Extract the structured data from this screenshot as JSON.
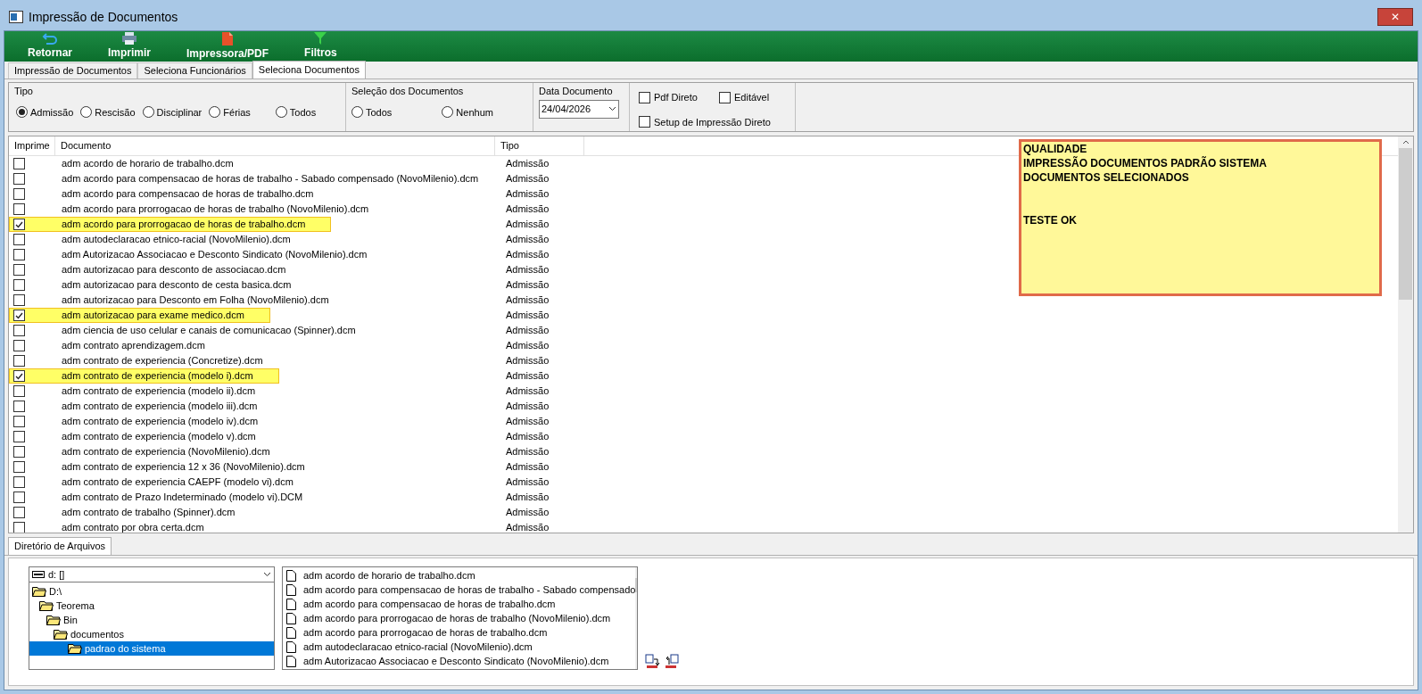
{
  "window": {
    "title": "Impressão de Documentos",
    "close": "✕"
  },
  "toolbar": [
    {
      "label": "Retornar",
      "kind": "return"
    },
    {
      "label": "Imprimir",
      "kind": "print"
    },
    {
      "label": "Impressora/PDF",
      "kind": "pdf"
    },
    {
      "label": "Filtros",
      "kind": "filter"
    }
  ],
  "tabs": [
    {
      "label": "Impressão de Documentos",
      "selected": false
    },
    {
      "label": "Seleciona Funcionários",
      "selected": false
    },
    {
      "label": "Seleciona Documentos",
      "selected": true
    }
  ],
  "tipo": {
    "title": "Tipo",
    "options": [
      {
        "label": "Admissão",
        "selected": true
      },
      {
        "label": "Rescisão",
        "selected": false
      },
      {
        "label": "Disciplinar",
        "selected": false
      },
      {
        "label": "Férias",
        "selected": false
      },
      {
        "label": "Todos",
        "selected": false
      }
    ]
  },
  "selecao": {
    "title": "Seleção dos Documentos",
    "options": [
      {
        "label": "Todos",
        "selected": false
      },
      {
        "label": "Nenhum",
        "selected": false
      }
    ]
  },
  "data_documento": {
    "title": "Data Documento",
    "value": "24/04/2026"
  },
  "options": [
    {
      "label": "Pdf Direto",
      "checked": false
    },
    {
      "label": "Editável",
      "checked": false
    },
    {
      "label": "Setup de Impressão Direto",
      "checked": false
    }
  ],
  "table": {
    "columns": [
      "Imprime",
      "Documento",
      "Tipo"
    ],
    "rows": [
      {
        "checked": false,
        "highlighted": false,
        "documento": "adm acordo de horario de trabalho.dcm",
        "tipo": "Admissão"
      },
      {
        "checked": false,
        "highlighted": false,
        "documento": "adm acordo para compensacao de horas de trabalho - Sabado compensado (NovoMilenio).dcm",
        "tipo": "Admissão"
      },
      {
        "checked": false,
        "highlighted": false,
        "documento": "adm acordo para compensacao de horas de trabalho.dcm",
        "tipo": "Admissão"
      },
      {
        "checked": false,
        "highlighted": false,
        "documento": "adm acordo para prorrogacao de horas de trabalho (NovoMilenio).dcm",
        "tipo": "Admissão"
      },
      {
        "checked": true,
        "highlighted": true,
        "documento": "adm acordo para prorrogacao de horas de trabalho.dcm",
        "tipo": "Admissão"
      },
      {
        "checked": false,
        "highlighted": false,
        "documento": "adm autodeclaracao etnico-racial (NovoMilenio).dcm",
        "tipo": "Admissão"
      },
      {
        "checked": false,
        "highlighted": false,
        "documento": "adm Autorizacao Associacao e Desconto Sindicato (NovoMilenio).dcm",
        "tipo": "Admissão"
      },
      {
        "checked": false,
        "highlighted": false,
        "documento": "adm autorizacao para desconto de associacao.dcm",
        "tipo": "Admissão"
      },
      {
        "checked": false,
        "highlighted": false,
        "documento": "adm autorizacao para desconto de cesta basica.dcm",
        "tipo": "Admissão"
      },
      {
        "checked": false,
        "highlighted": false,
        "documento": "adm autorizacao para Desconto em Folha (NovoMilenio).dcm",
        "tipo": "Admissão"
      },
      {
        "checked": true,
        "highlighted": true,
        "documento": "adm autorizacao para exame medico.dcm",
        "tipo": "Admissão"
      },
      {
        "checked": false,
        "highlighted": false,
        "documento": "adm ciencia de uso celular e canais de comunicacao (Spinner).dcm",
        "tipo": "Admissão"
      },
      {
        "checked": false,
        "highlighted": false,
        "documento": "adm contrato aprendizagem.dcm",
        "tipo": "Admissão"
      },
      {
        "checked": false,
        "highlighted": false,
        "documento": "adm contrato de experiencia (Concretize).dcm",
        "tipo": "Admissão"
      },
      {
        "checked": true,
        "highlighted": true,
        "documento": "adm contrato de experiencia (modelo i).dcm",
        "tipo": "Admissão"
      },
      {
        "checked": false,
        "highlighted": false,
        "documento": "adm contrato de experiencia (modelo ii).dcm",
        "tipo": "Admissão"
      },
      {
        "checked": false,
        "highlighted": false,
        "documento": "adm contrato de experiencia (modelo iii).dcm",
        "tipo": "Admissão"
      },
      {
        "checked": false,
        "highlighted": false,
        "documento": "adm contrato de experiencia (modelo iv).dcm",
        "tipo": "Admissão"
      },
      {
        "checked": false,
        "highlighted": false,
        "documento": "adm contrato de experiencia (modelo v).dcm",
        "tipo": "Admissão"
      },
      {
        "checked": false,
        "highlighted": false,
        "documento": "adm contrato de experiencia (NovoMilenio).dcm",
        "tipo": "Admissão"
      },
      {
        "checked": false,
        "highlighted": false,
        "documento": "adm contrato de experiencia 12 x 36 (NovoMilenio).dcm",
        "tipo": "Admissão"
      },
      {
        "checked": false,
        "highlighted": false,
        "documento": "adm contrato de experiencia CAEPF (modelo vi).dcm",
        "tipo": "Admissão"
      },
      {
        "checked": false,
        "highlighted": false,
        "documento": "adm contrato de Prazo Indeterminado (modelo vi).DCM",
        "tipo": "Admissão"
      },
      {
        "checked": false,
        "highlighted": false,
        "documento": "adm contrato de trabalho (Spinner).dcm",
        "tipo": "Admissão"
      },
      {
        "checked": false,
        "highlighted": false,
        "documento": "adm contrato por obra certa.dcm",
        "tipo": "Admissão"
      }
    ]
  },
  "note": {
    "paragraphs": [
      [
        "QUALIDADE",
        "IMPRESSÃO DOCUMENTOS PADRÃO SISTEMA",
        "DOCUMENTOS SELECIONADOS"
      ],
      [
        "TESTE OK"
      ]
    ]
  },
  "bottom_tab": {
    "label": "Diretório de Arquivos",
    "selected": true
  },
  "drive": {
    "value": "d: []"
  },
  "folders": [
    {
      "label": "D:\\",
      "selected": false,
      "children": [
        {
          "label": "Teorema",
          "selected": false,
          "children": [
            {
              "label": "Bin",
              "selected": false,
              "children": [
                {
                  "label": "documentos",
                  "selected": false,
                  "children": [
                    {
                      "label": "padrao do sistema",
                      "selected": true
                    }
                  ]
                }
              ]
            }
          ]
        }
      ]
    }
  ],
  "files": [
    "adm acordo de horario de trabalho.dcm",
    "adm acordo para compensacao de horas de trabalho - Sabado compensado",
    "adm acordo para compensacao de horas de trabalho.dcm",
    "adm acordo para prorrogacao de horas de trabalho (NovoMilenio).dcm",
    "adm acordo para prorrogacao de horas de trabalho.dcm",
    "adm autodeclaracao etnico-racial (NovoMilenio).dcm",
    "adm Autorizacao Associacao e Desconto Sindicato (NovoMilenio).dcm"
  ]
}
